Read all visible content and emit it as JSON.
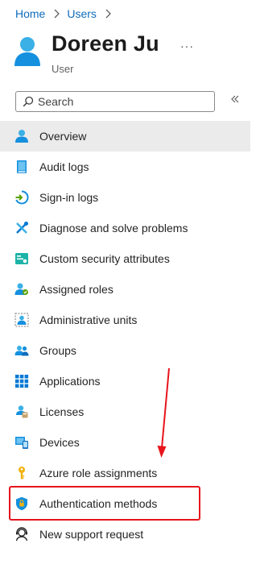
{
  "breadcrumb": {
    "home": "Home",
    "users": "Users"
  },
  "header": {
    "name": "Doreen Ju",
    "type": "User",
    "more": "···"
  },
  "search": {
    "placeholder": "Search",
    "value": ""
  },
  "collapse_icon": "chevron-double-left-icon",
  "nav": {
    "items": [
      {
        "label": "Overview",
        "icon": "user-icon",
        "selected": true
      },
      {
        "label": "Audit logs",
        "icon": "book-icon"
      },
      {
        "label": "Sign-in logs",
        "icon": "sign-in-icon"
      },
      {
        "label": "Diagnose and solve problems",
        "icon": "tools-icon"
      },
      {
        "label": "Custom security attributes",
        "icon": "attribute-icon"
      },
      {
        "label": "Assigned roles",
        "icon": "user-role-icon"
      },
      {
        "label": "Administrative units",
        "icon": "admin-unit-icon"
      },
      {
        "label": "Groups",
        "icon": "groups-icon"
      },
      {
        "label": "Applications",
        "icon": "grid-icon"
      },
      {
        "label": "Licenses",
        "icon": "license-icon"
      },
      {
        "label": "Devices",
        "icon": "devices-icon"
      },
      {
        "label": "Azure role assignments",
        "icon": "key-icon"
      },
      {
        "label": "Authentication methods",
        "icon": "shield-icon"
      },
      {
        "label": "New support request",
        "icon": "support-icon"
      }
    ]
  },
  "colors": {
    "link": "#0f6cbd",
    "selected_bg": "#ebebeb",
    "annotation": "#e8141c"
  }
}
